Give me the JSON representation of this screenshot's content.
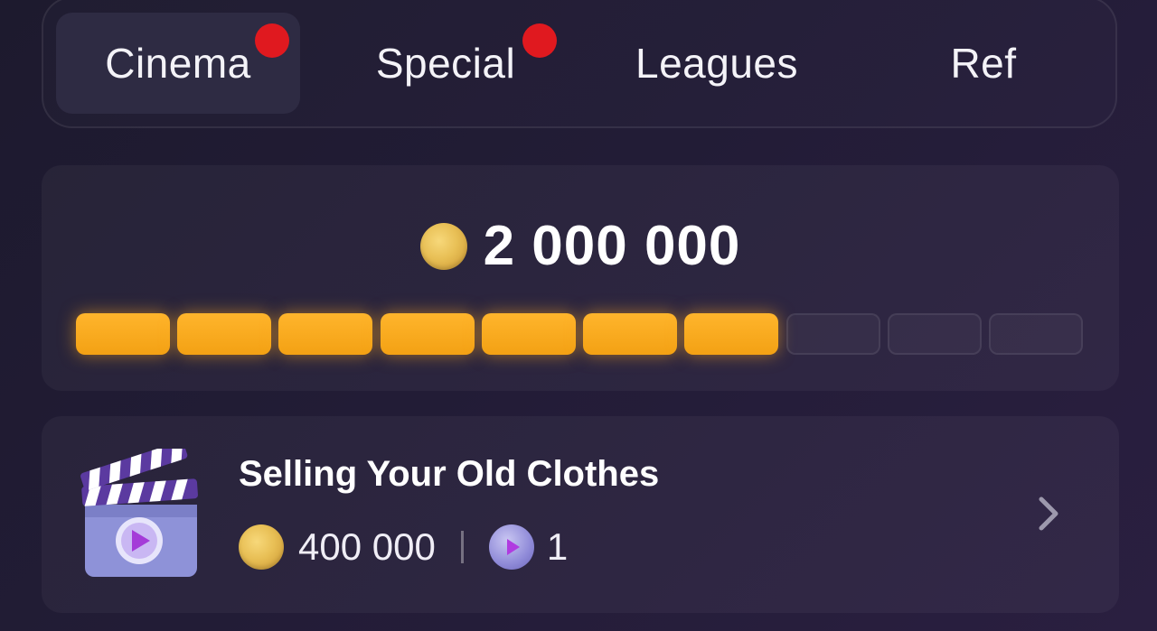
{
  "tabs": [
    {
      "label": "Cinema",
      "active": true,
      "has_notification": true
    },
    {
      "label": "Special",
      "active": false,
      "has_notification": true
    },
    {
      "label": "Leagues",
      "active": false,
      "has_notification": false
    },
    {
      "label": "Ref",
      "active": false,
      "has_notification": false
    }
  ],
  "progress": {
    "reward_icon": "coin-icon",
    "reward_amount": "2 000 000",
    "segments_total": 10,
    "segments_filled": 7
  },
  "task": {
    "icon": "clapperboard-icon",
    "title": "Selling Your Old Clothes",
    "coin_reward": "400 000",
    "ticket_count": "1",
    "action_icon": "chevron-right-icon"
  },
  "colors": {
    "accent": "#f3a114",
    "notification": "#e0191f",
    "background": "#1d1a2e"
  }
}
